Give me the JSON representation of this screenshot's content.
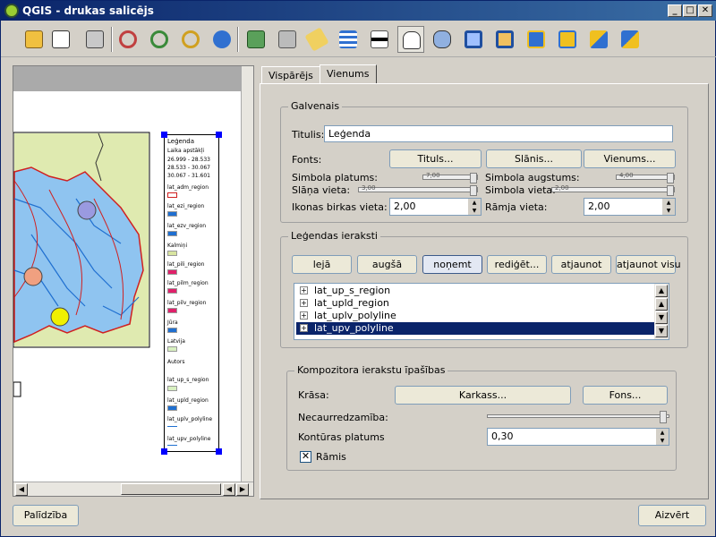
{
  "window": {
    "title": "QGIS - drukas salicējs"
  },
  "toolbar": {
    "icons": [
      "load-template-icon",
      "save-template-icon",
      "print-icon",
      "zoom-full-icon",
      "zoom-in-icon",
      "zoom-out-icon",
      "refresh-icon",
      "add-map-icon",
      "add-image-icon",
      "add-label-icon",
      "add-legend-icon",
      "add-scalebar-icon",
      "select-move-icon",
      "move-content-icon",
      "group-icon",
      "ungroup-icon",
      "raise-icon",
      "lower-icon",
      "move-top-icon",
      "move-bottom-icon"
    ]
  },
  "legend_preview": {
    "title": "Leģenda",
    "subtitle": "Laika apstākļi",
    "ranges": [
      "26.999 - 28.533",
      "28.533 - 30.067",
      "30.067 - 31.601"
    ],
    "layers": [
      "lat_adm_region",
      "lat_ezi_region",
      "lat_ezv_region",
      "Kalmiņi",
      "lat_pili_region",
      "lat_pilm_region",
      "lat_pilv_region",
      "Jūra",
      "Latvija",
      "Autors",
      "lat_up_s_region",
      "lat_upld_region",
      "lat_uplv_polyline",
      "lat_upv_polyline"
    ]
  },
  "tabs": [
    {
      "label": "Vispārējs",
      "active": false
    },
    {
      "label": "Vienums",
      "active": true
    }
  ],
  "general": {
    "group_label": "Galvenais",
    "title_label": "Titulis:",
    "title_value": "Leģenda",
    "fonts_label": "Fonts:",
    "btn_title": "Tituls...",
    "btn_layer": "Slānis...",
    "btn_item": "Vienums...",
    "symbol_width_label": "Simbola platums:",
    "symbol_width_value": "7,00",
    "symbol_height_label": "Simbola augstums:",
    "symbol_height_value": "4,00",
    "layer_space_label": "Slāņa vieta:",
    "layer_space_value": "3,00",
    "symbol_space_label": "Simbola vieta:",
    "symbol_space_value": "2,00",
    "icon_label_space_label": "Ikonas birkas vieta:",
    "icon_label_space_value": "2,00",
    "box_space_label": "Rāmja vieta:",
    "box_space_value": "2,00"
  },
  "entries": {
    "group_label": "Leģendas ieraksti",
    "buttons": [
      "lejā",
      "augšā",
      "noņemt",
      "rediģēt...",
      "atjaunot",
      "atjaunot visu"
    ],
    "items": [
      "lat_up_s_region",
      "lat_upld_region",
      "lat_uplv_polyline",
      "lat_upv_polyline"
    ],
    "selected_index": 3
  },
  "composer": {
    "group_label": "Kompozitora ierakstu īpašības",
    "color_label": "Krāsa:",
    "btn_frame": "Karkass...",
    "btn_background": "Fons...",
    "opacity_label": "Necaurredzamība:",
    "opacity_value": 1.0,
    "outline_label": "Kontūras platums",
    "outline_value": "0,30",
    "frame_label": "Rāmis",
    "frame_checked": true
  },
  "footer": {
    "help": "Palīdzība",
    "close": "Aizvērt"
  },
  "colors": {
    "titlebar": "#0a246a",
    "selection": "#0a246a",
    "map_fill": "#dfeab0",
    "river": "#1f6fd0",
    "border": "#d02020"
  }
}
